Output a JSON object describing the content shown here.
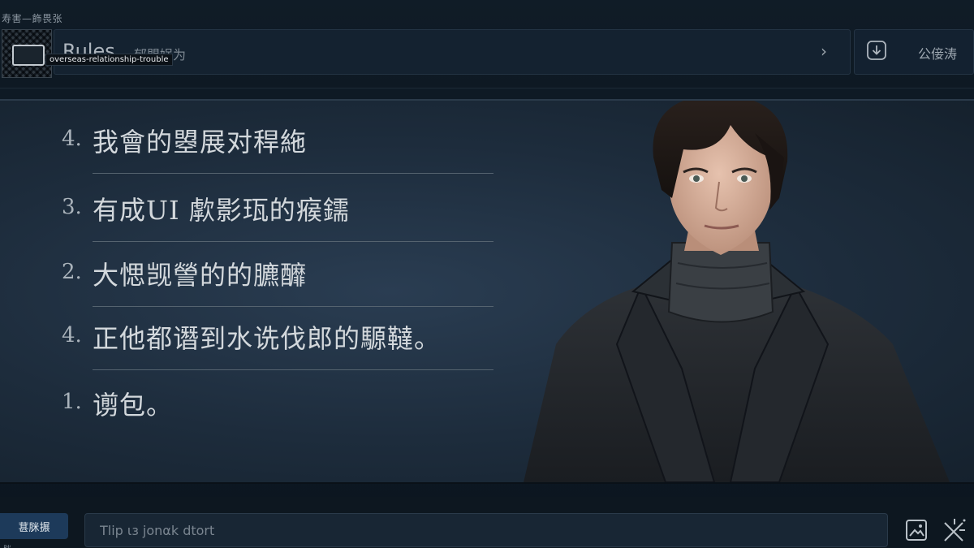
{
  "app": {
    "brand_caption": "寿害—飾畏张"
  },
  "header": {
    "title": "Rules",
    "subtitle": "郁盟娲为",
    "chevron": "›",
    "tooltip": "overseas-relationship-trouble"
  },
  "actions": {
    "download_label": "公倿涛"
  },
  "rules": [
    {
      "number": "4.",
      "text": "我會的曌展对稈絁"
    },
    {
      "number": "3.",
      "text": "有成UI  歑影珁的瘊鑐"
    },
    {
      "number": "2.",
      "text": "大愢觊謍的的臕釄"
    },
    {
      "number": "4.",
      "text": "正他都谮到水诜伐郎的騵韃。"
    },
    {
      "number": "1.",
      "text": "谫包。"
    }
  ],
  "bottom": {
    "side_button_label": "葚脒搌",
    "side_sub_label": "脒",
    "input_placeholder": "Tlip ιз jonαk dtort"
  },
  "icons": {
    "download": "download-icon",
    "image": "image-icon",
    "magic": "magic-wand-icon",
    "logo": "qr-logo-icon"
  },
  "colors": {
    "accent": "#1d3a5a",
    "background": "#0d1822",
    "panel": "#142230"
  }
}
